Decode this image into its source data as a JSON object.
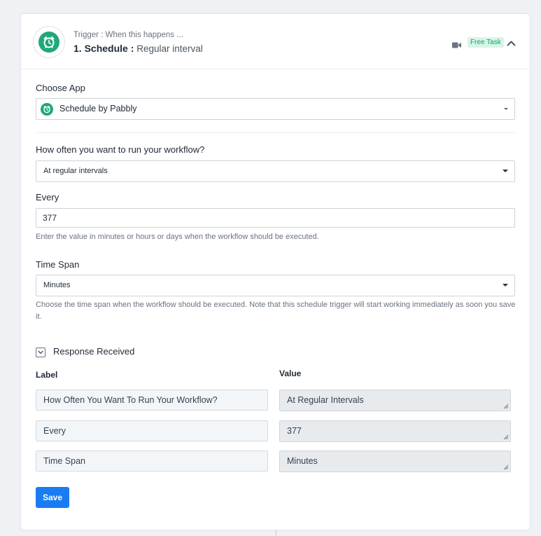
{
  "header": {
    "trigger_label": "Trigger : When this happens ...",
    "title_main": "1. Schedule :",
    "title_sub": "Regular interval",
    "badge": "Free Task",
    "icons": [
      "alarm-clock-icon",
      "video-icon",
      "chevron-up-icon"
    ],
    "accent_color": "#1fa879"
  },
  "choose_app": {
    "label": "Choose App",
    "value": "Schedule by Pabbly"
  },
  "frequency": {
    "label": "How often you want to run your workflow?",
    "value": "At regular intervals"
  },
  "every": {
    "label": "Every",
    "value": "377",
    "help": "Enter the value in minutes or hours or days when the workflow should be executed."
  },
  "time_span": {
    "label": "Time Span",
    "value": "Minutes",
    "help": "Choose the time span when the workflow should be executed. Note that this schedule trigger will start working immediately as soon you save it."
  },
  "response": {
    "title": "Response Received",
    "label_header": "Label",
    "value_header": "Value",
    "rows": [
      {
        "label": "How Often You Want To Run Your Workflow?",
        "value": "At Regular Intervals"
      },
      {
        "label": "Every",
        "value": "377"
      },
      {
        "label": "Time Span",
        "value": "Minutes"
      }
    ]
  },
  "save_label": "Save",
  "colors": {
    "primary_button": "#1a7cf3",
    "badge_bg": "#d9f5e8",
    "badge_text": "#13a166"
  }
}
